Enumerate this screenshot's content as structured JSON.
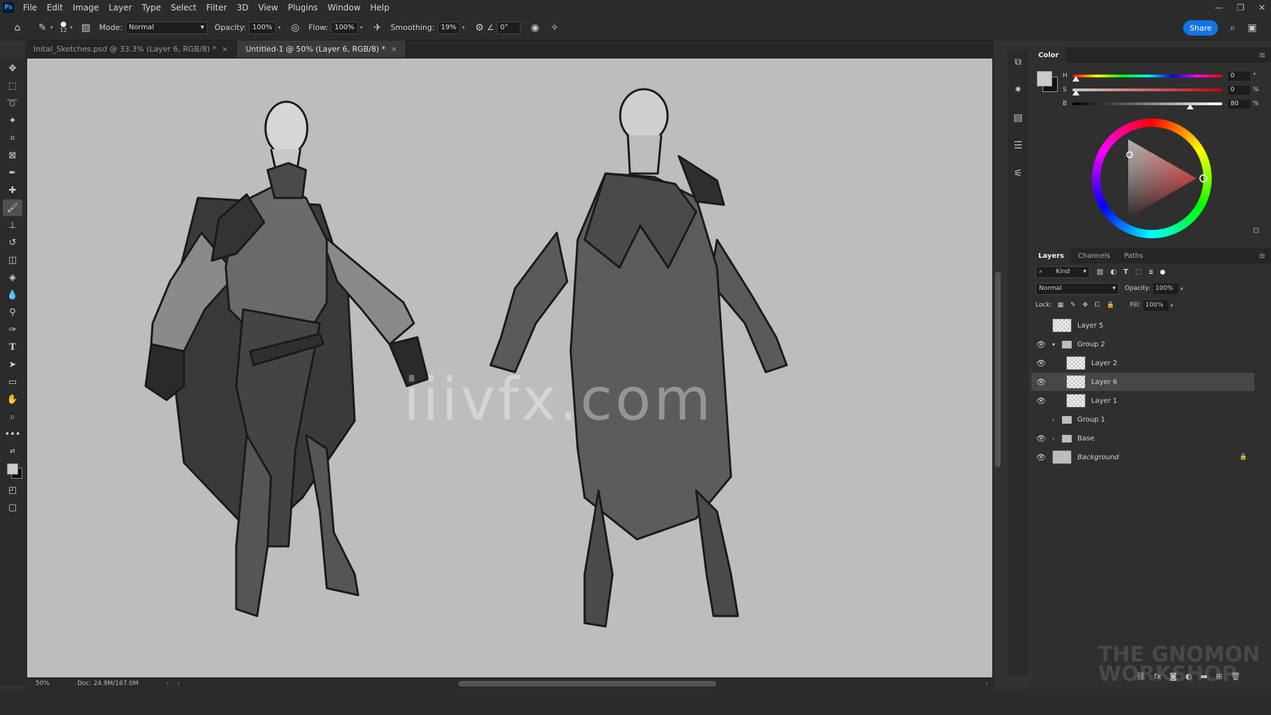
{
  "menu": [
    "File",
    "Edit",
    "Image",
    "Layer",
    "Type",
    "Select",
    "Filter",
    "3D",
    "View",
    "Plugins",
    "Window",
    "Help"
  ],
  "options": {
    "brush_size": "12",
    "mode_label": "Mode:",
    "mode_value": "Normal",
    "opacity_label": "Opacity:",
    "opacity_value": "100%",
    "flow_label": "Flow:",
    "flow_value": "100%",
    "smoothing_label": "Smoothing:",
    "smoothing_value": "19%",
    "angle_value": "0°",
    "share_label": "Share"
  },
  "tabs": [
    {
      "label": "Inital_Sketches.psd @ 33.3% (Layer 6, RGB/8) *"
    },
    {
      "label": "Untitled-1 @ 50% (Layer 6, RGB/8) *"
    }
  ],
  "status": {
    "zoom": "50%",
    "doc": "Doc: 24.9M/167.0M"
  },
  "watermark": "iiivfx.com",
  "color_panel": {
    "title": "Color",
    "h_label": "H",
    "h_value": "0",
    "h_unit": "°",
    "h_level": 0,
    "s_label": "S",
    "s_value": "0",
    "s_unit": "%",
    "s_level": 0,
    "b_label": "B",
    "b_value": "80",
    "b_unit": "%",
    "b_level": 0.8
  },
  "layers_panel": {
    "tabs": [
      "Layers",
      "Channels",
      "Paths"
    ],
    "kind_label": "Kind",
    "blend_mode": "Normal",
    "opacity_label": "Opacity:",
    "opacity_value": "100%",
    "lock_label": "Lock:",
    "fill_label": "Fill:",
    "fill_value": "100%",
    "layers": [
      {
        "name": "Layer 5",
        "visible": false,
        "type": "layer",
        "indent": 0
      },
      {
        "name": "Group 2",
        "visible": true,
        "type": "group",
        "indent": 0,
        "expanded": true
      },
      {
        "name": "Layer 2",
        "visible": true,
        "type": "layer",
        "indent": 1
      },
      {
        "name": "Layer 6",
        "visible": true,
        "type": "layer",
        "indent": 1,
        "selected": true
      },
      {
        "name": "Layer 1",
        "visible": true,
        "type": "layer",
        "indent": 1
      },
      {
        "name": "Group 1",
        "visible": false,
        "type": "group",
        "indent": 0,
        "expanded": false
      },
      {
        "name": "Base",
        "visible": true,
        "type": "group",
        "indent": 0,
        "expanded": false
      },
      {
        "name": "Background",
        "visible": true,
        "type": "background",
        "indent": 0,
        "locked": true
      }
    ]
  },
  "brand_watermark": {
    "line1": "THE GNOMON",
    "line2": "WORKSHOP"
  }
}
